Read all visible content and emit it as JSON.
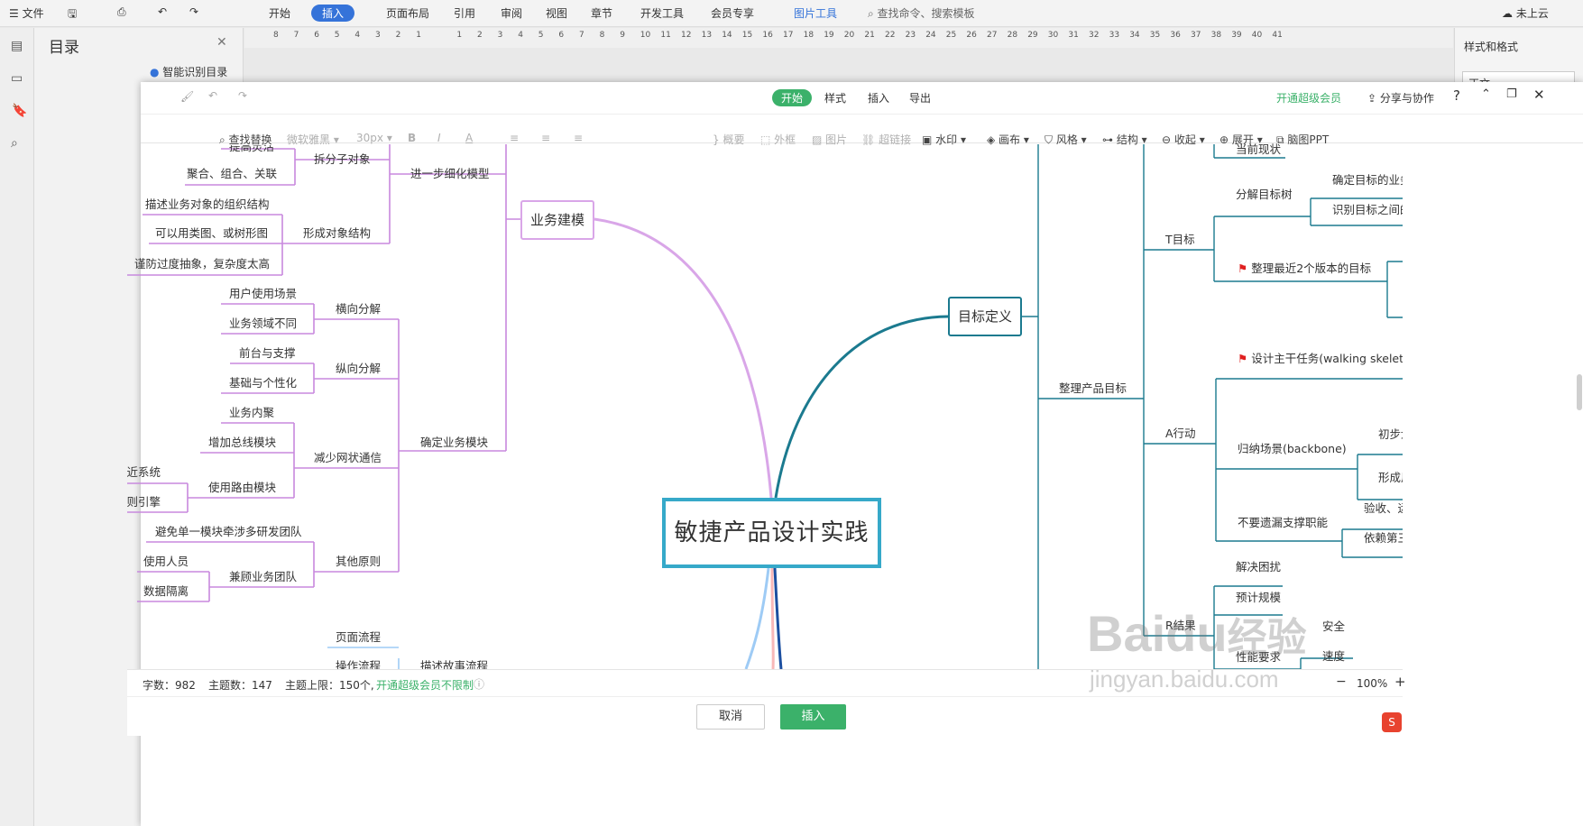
{
  "wps": {
    "file_menu": "文件",
    "tabs": [
      "开始",
      "插入",
      "页面布局",
      "引用",
      "审阅",
      "视图",
      "章节",
      "开发工具",
      "会员专享"
    ],
    "picture_tools": "图片工具",
    "search_placeholder": "查找命令、搜索模板",
    "cloud": "未上云"
  },
  "ruler": [
    "8",
    "7",
    "6",
    "5",
    "4",
    "3",
    "2",
    "1",
    "",
    "1",
    "2",
    "3",
    "4",
    "5",
    "6",
    "7",
    "8",
    "9",
    "10",
    "11",
    "12",
    "13",
    "14",
    "15",
    "16",
    "17",
    "18",
    "19",
    "20",
    "21",
    "22",
    "23",
    "24",
    "25",
    "26",
    "27",
    "28",
    "29",
    "30",
    "31",
    "32",
    "33",
    "34",
    "35",
    "36",
    "37",
    "38",
    "39",
    "40",
    "41"
  ],
  "toc": {
    "title": "目录",
    "smart": "智能识别目录"
  },
  "right_panel": {
    "title": "样式和格式",
    "style_name": "正文"
  },
  "dialog": {
    "top_tabs": [
      "开始",
      "样式",
      "插入",
      "导出"
    ],
    "vip": "开通超级会员",
    "share": "分享与协作",
    "tools": [
      "查找替换",
      "微软雅黑",
      "30px",
      "B",
      "I",
      "A",
      "概要",
      "外框",
      "图片",
      "超链接",
      "水印",
      "画布",
      "风格",
      "结构",
      "收起",
      "展开",
      "脑图PPT"
    ],
    "status": {
      "words": "字数：982",
      "topics": "主题数：147",
      "limit": "主题上限：150个,",
      "vip_link": "开通超级会员不限制",
      "zoom": "100%"
    },
    "cancel": "取消",
    "insert": "插入"
  },
  "mindmap": {
    "central": "敏捷产品设计实践",
    "n_business": "业务建模",
    "n_goal": "目标定义",
    "left": {
      "l1": "进一步细化模型",
      "l2": "拆分子对象",
      "l3": "提高灵活",
      "l4": "聚合、组合、关联",
      "l5": "形成对象结构",
      "l6": "描述业务对象的组织结构",
      "l7": "可以用类图、或树形图",
      "l8": "谨防过度抽象，复杂度太高",
      "l9": "确定业务模块",
      "l10": "横向分解",
      "l11": "用户使用场景",
      "l12": "业务领域不同",
      "l13": "纵向分解",
      "l14": "前台与支撑",
      "l15": "基础与个性化",
      "l16": "减少网状通信",
      "l17": "业务内聚",
      "l18": "增加总线模块",
      "l19": "使用路由模块",
      "l20": "就近系统",
      "l21": "规则引擎",
      "l22": "其他原则",
      "l23": "避免单一模块牵涉多研发团队",
      "l24": "兼顾业务团队",
      "l25": "使用人员",
      "l26": "数据隔离",
      "l27": "页面流程",
      "l28": "操作流程",
      "l29": "描述故事流程"
    },
    "right": {
      "r1": "整理产品目标",
      "r2": "当前现状",
      "r3": "T目标",
      "r4": "分解目标树",
      "r5": "确定目标的业务价值",
      "r6": "识别目标之间的依赖",
      "r7": "整理最近2个版本的目标",
      "r8": "A行动",
      "r9": "设计主干任务(walking skeleton)",
      "r10": "归纳场景(backbone)",
      "r11": "初步划分",
      "r12": "形成用户",
      "r13": "不要遗漏支撑职能",
      "r14": "验收、运营",
      "r15": "依赖第三方",
      "r16": "R结果",
      "r17": "解决困扰",
      "r18": "预计规模",
      "r19": "性能要求",
      "r20": "安全",
      "r21": "速度"
    }
  },
  "watermark": {
    "brand": "Baidu",
    "sub": "经验",
    "url": "jingyan.baidu.com"
  }
}
